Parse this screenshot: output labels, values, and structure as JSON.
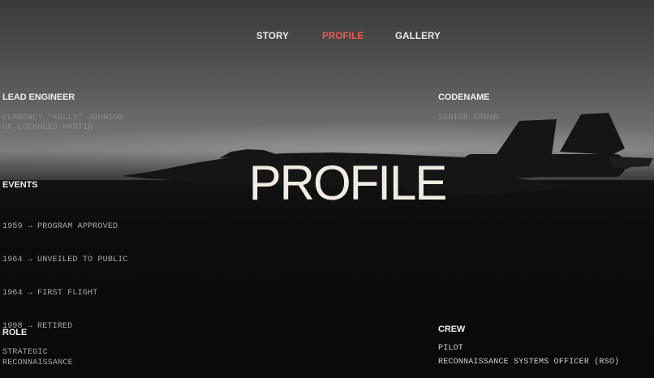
{
  "nav": {
    "items": [
      {
        "label": "STORY",
        "active": false
      },
      {
        "label": "PROFILE",
        "active": true
      },
      {
        "label": "GALLERY",
        "active": false
      }
    ],
    "active_color": "#ec5b50"
  },
  "hero": {
    "title": "PROFILE"
  },
  "lead_engineer": {
    "heading": "LEAD ENGINEER",
    "line1": "CLARENCY \"KELLY\" JOHNSON",
    "line2": "OF LOCKHEED MARTIN"
  },
  "codename": {
    "heading": "CODENAME",
    "value": "SENIOR CROWN"
  },
  "events": {
    "heading": "EVENTS",
    "arrow": "→",
    "items": [
      {
        "year": "1959",
        "text": "PROGRAM APPROVED"
      },
      {
        "year": "1964",
        "text": "UNVEILED TO PUBLIC"
      },
      {
        "year": "1964",
        "text": "FIRST FLIGHT"
      },
      {
        "year": "1998",
        "text": "RETIRED"
      }
    ]
  },
  "role": {
    "heading": "ROLE",
    "line1": "STRATEGIC",
    "line2": "RECONNAISSANCE"
  },
  "crew": {
    "heading": "CREW",
    "line1": "PILOT",
    "line2": "RECONNAISSANCE SYSTEMS OFFICER (RSO)"
  },
  "background": {
    "image": "jet-silhouette-icon"
  }
}
